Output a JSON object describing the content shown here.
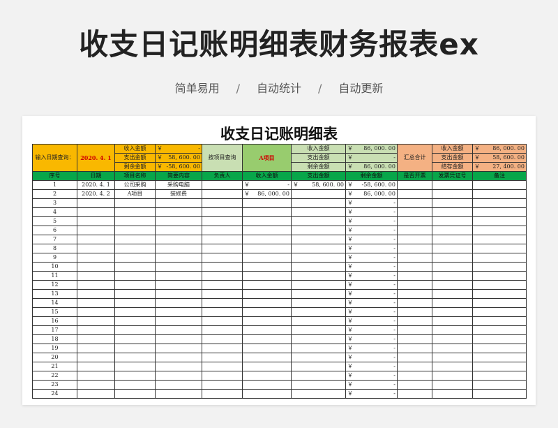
{
  "headline": "收支日记账明细表财务报表ex",
  "tagline": [
    "简单易用",
    "自动统计",
    "自动更新"
  ],
  "tagline_sep": "/",
  "sheet_title": "收支日记账明细表",
  "summary": {
    "date_query_label": "输入日期查询：",
    "date_value": "2020. 4. 1",
    "income_label": "收入金额",
    "expense_label": "支出金额",
    "balance_label": "剩余金额",
    "date_income": "-",
    "date_expense": "58, 600. 00",
    "date_balance": "-58, 600. 00",
    "project_query_label": "按项目查询",
    "project_value": "A项目",
    "project_income": "86, 000. 00",
    "project_expense": "-",
    "project_balance": "86, 000. 00",
    "total_label": "汇总合计",
    "total_income_label": "收入金额",
    "total_expense_label": "支出金额",
    "total_stock_label": "结存金额",
    "total_income": "86, 000. 00",
    "total_expense": "58, 600. 00",
    "total_stock": "27, 400. 00",
    "currency": "￥"
  },
  "columns": [
    "序号",
    "日期",
    "项目名称",
    "简要内容",
    "负责人",
    "收入金额",
    "支出金额",
    "剩余金额",
    "是否开票",
    "发票凭证号",
    "备注"
  ],
  "currency": "￥",
  "rows": [
    {
      "no": "1",
      "date": "2020. 4. 1",
      "project": "公司采购",
      "content": "采购电脑",
      "owner": "",
      "income": "-",
      "expense": "58, 600. 00",
      "balance": "-58, 600. 00"
    },
    {
      "no": "2",
      "date": "2020. 4. 2",
      "project": "A项目",
      "content": "装修费",
      "owner": "",
      "income": "86, 000. 00",
      "expense": "",
      "balance": "86, 000. 00"
    },
    {
      "no": "3",
      "balance": "-"
    },
    {
      "no": "4",
      "balance": "-"
    },
    {
      "no": "5",
      "balance": "-"
    },
    {
      "no": "6",
      "balance": "-"
    },
    {
      "no": "7",
      "balance": "-"
    },
    {
      "no": "8",
      "balance": "-"
    },
    {
      "no": "9",
      "balance": "-"
    },
    {
      "no": "10",
      "balance": "-"
    },
    {
      "no": "11",
      "balance": "-"
    },
    {
      "no": "12",
      "balance": "-"
    },
    {
      "no": "13",
      "balance": "-"
    },
    {
      "no": "14",
      "balance": "-"
    },
    {
      "no": "15",
      "balance": "-"
    },
    {
      "no": "16",
      "balance": "-"
    },
    {
      "no": "17",
      "balance": "-"
    },
    {
      "no": "18",
      "balance": "-"
    },
    {
      "no": "19",
      "balance": "-"
    },
    {
      "no": "20",
      "balance": "-"
    },
    {
      "no": "21",
      "balance": "-"
    },
    {
      "no": "22",
      "balance": "-"
    },
    {
      "no": "23",
      "balance": "-"
    },
    {
      "no": "24",
      "balance": "-"
    }
  ]
}
